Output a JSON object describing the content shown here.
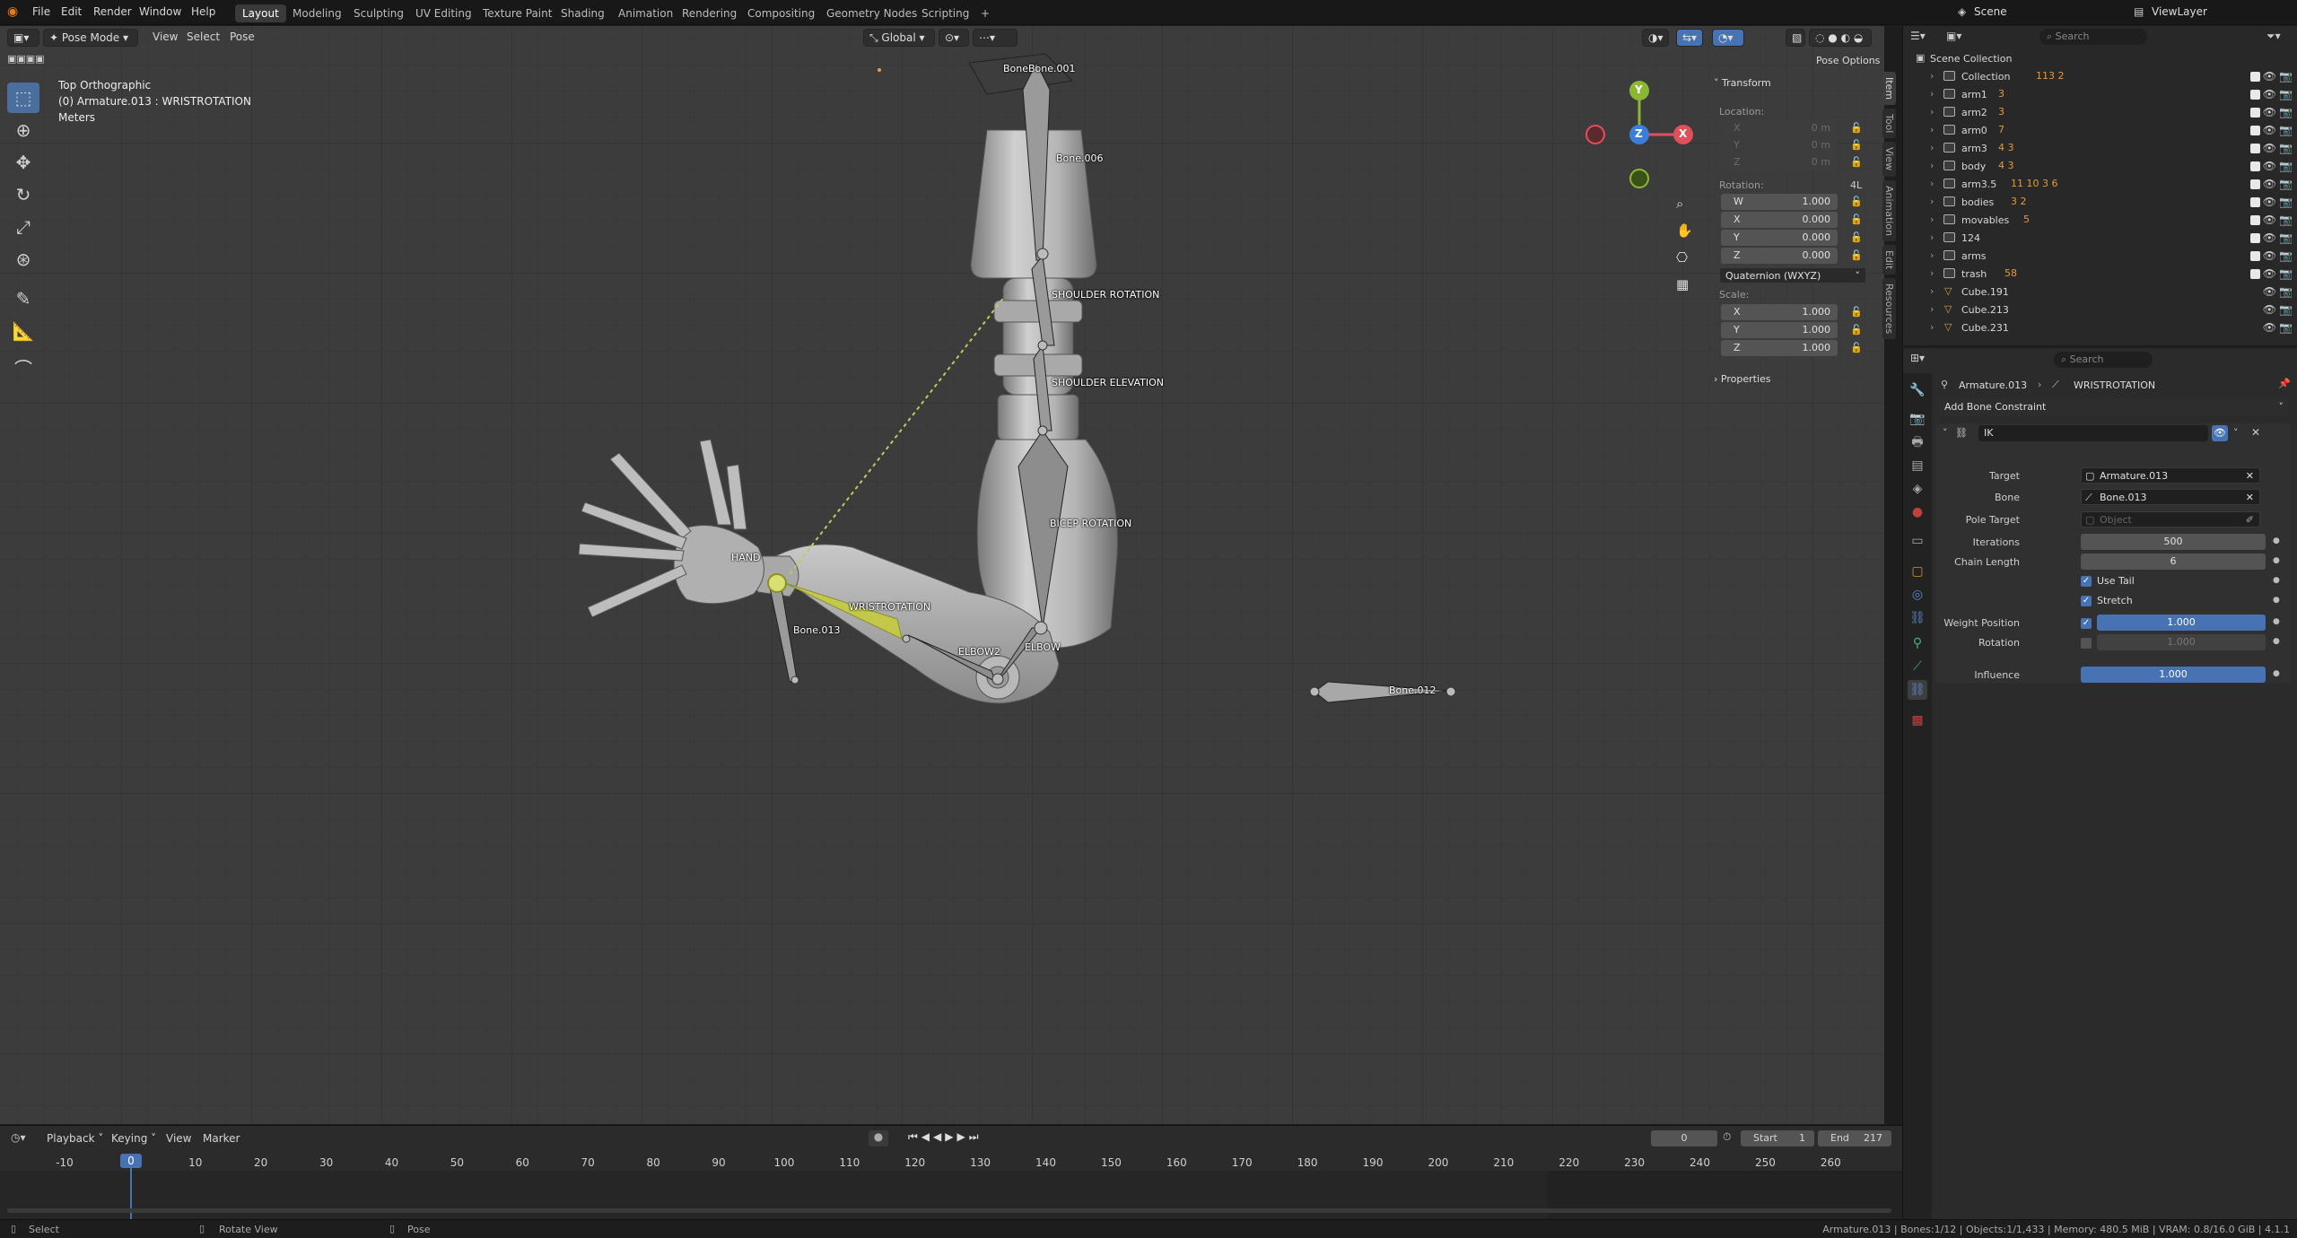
{
  "menubar": {
    "items": [
      "File",
      "Edit",
      "Render",
      "Window",
      "Help"
    ],
    "workspaces": [
      "Layout",
      "Modeling",
      "Sculpting",
      "UV Editing",
      "Texture Paint",
      "Shading",
      "Animation",
      "Rendering",
      "Compositing",
      "Geometry Nodes",
      "Scripting"
    ],
    "active_workspace": "Layout",
    "add_tab": "+",
    "scene": "Scene",
    "viewlayer": "ViewLayer"
  },
  "viewport_header": {
    "mode": "Pose Mode",
    "menus": [
      "View",
      "Select",
      "Pose"
    ],
    "orientation": "Global",
    "pose_options": "Pose Options"
  },
  "viewport_info": {
    "view": "Top Orthographic",
    "object": "(0) Armature.013 : WRISTROTATION",
    "units": "Meters"
  },
  "bones": {
    "b1": "BoneBone.001",
    "b2": "Bone.006",
    "b3": "SHOULDER ROTATION",
    "b4": "SHOULDER ELEVATION",
    "b5": "BICEP ROTATION",
    "b6": "HAND",
    "b7": "WRISTROTATION",
    "b8": "Bone.013",
    "b9": "ELBOW2",
    "b10": "ELBOW",
    "b11": "Bone.012"
  },
  "gizmo": {
    "y": "Y",
    "x": "X",
    "z": "Z"
  },
  "npanel": {
    "transform_title": "Transform",
    "location_label": "Location:",
    "location": [
      {
        "axis": "X",
        "value": "0 m"
      },
      {
        "axis": "Y",
        "value": "0 m"
      },
      {
        "axis": "Z",
        "value": "0 m"
      }
    ],
    "rotation_label": "Rotation:",
    "rotation_mode_short": "4L",
    "rotation": [
      {
        "axis": "W",
        "value": "1.000"
      },
      {
        "axis": "X",
        "value": "0.000"
      },
      {
        "axis": "Y",
        "value": "0.000"
      },
      {
        "axis": "Z",
        "value": "0.000"
      }
    ],
    "rotation_mode": "Quaternion (WXYZ)",
    "scale_label": "Scale:",
    "scale": [
      {
        "axis": "X",
        "value": "1.000"
      },
      {
        "axis": "Y",
        "value": "1.000"
      },
      {
        "axis": "Z",
        "value": "1.000"
      }
    ],
    "properties_title": "Properties",
    "tabs": [
      "Item",
      "Tool",
      "View",
      "Animation",
      "Edit",
      "Resources"
    ]
  },
  "outliner": {
    "search_placeholder": "Search",
    "root": "Scene Collection",
    "rows": [
      {
        "name": "Collection",
        "badge": "113 2"
      },
      {
        "name": "arm1",
        "badge": "3"
      },
      {
        "name": "arm2",
        "badge": "3"
      },
      {
        "name": "arm0",
        "badge": "7"
      },
      {
        "name": "arm3",
        "badge": "4 3"
      },
      {
        "name": "body",
        "badge": "4 3"
      },
      {
        "name": "arm3.5",
        "badge": "11 10 3 6"
      },
      {
        "name": "bodies",
        "badge": "3 2"
      },
      {
        "name": "movables",
        "badge": "5"
      },
      {
        "name": "124",
        "badge": ""
      },
      {
        "name": "arms",
        "badge": ""
      },
      {
        "name": "trash",
        "badge": "58"
      },
      {
        "name": "Cube.191",
        "badge": ""
      },
      {
        "name": "Cube.213",
        "badge": ""
      },
      {
        "name": "Cube.231",
        "badge": ""
      }
    ]
  },
  "properties": {
    "search_placeholder": "Search",
    "breadcrumb_object": "Armature.013",
    "breadcrumb_bone": "WRISTROTATION",
    "add_constraint": "Add Bone Constraint",
    "constraint_name": "IK",
    "target_label": "Target",
    "target_value": "Armature.013",
    "bone_label": "Bone",
    "bone_value": "Bone.013",
    "pole_label": "Pole Target",
    "pole_placeholder": "Object",
    "iterations_label": "Iterations",
    "iterations_value": "500",
    "chain_label": "Chain Length",
    "chain_value": "6",
    "use_tail_label": "Use Tail",
    "stretch_label": "Stretch",
    "weight_position_label": "Weight Position",
    "weight_position_value": "1.000",
    "rotation_label": "Rotation",
    "rotation_value": "1.000",
    "influence_label": "Influence",
    "influence_value": "1.000"
  },
  "timeline": {
    "menus": [
      "Playback",
      "Keying",
      "View",
      "Marker"
    ],
    "current_frame": "0",
    "start_label": "Start",
    "start_value": "1",
    "end_label": "End",
    "end_value": "217",
    "ticks": [
      "-10",
      "0",
      "10",
      "20",
      "30",
      "40",
      "50",
      "60",
      "70",
      "80",
      "90",
      "100",
      "110",
      "120",
      "130",
      "140",
      "150",
      "160",
      "170",
      "180",
      "190",
      "200",
      "210",
      "220",
      "230",
      "240",
      "250",
      "260"
    ]
  },
  "statusbar": {
    "select": "Select",
    "rotate": "Rotate View",
    "pose": "Pose",
    "stats": "Armature.013 | Bones:1/12 | Objects:1/1,433 | Memory: 480.5 MiB | VRAM: 0.8/16.0 GiB | 4.1.1"
  }
}
